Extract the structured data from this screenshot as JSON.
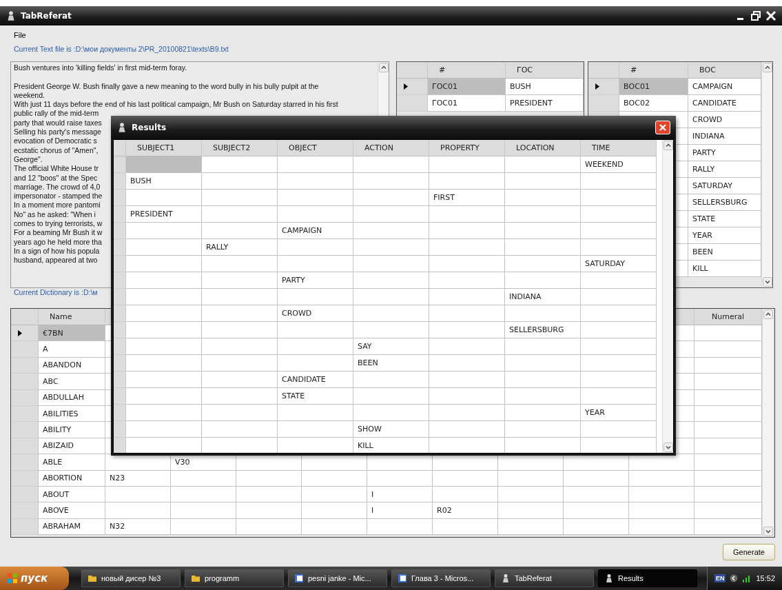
{
  "window": {
    "title": "TabReferat"
  },
  "menu": [
    "File"
  ],
  "text_file_label": "Current Text file is :D:\\мои документы 2\\PR_20100821\\texts\\B9.txt",
  "text_heading": "Bush ventures into 'killing fields' in first mid-term foray.",
  "text_lines": [
    "President George W. Bush finally gave a new meaning to the word bully in his bully pulpit at the",
    "weekend.",
    "With just 11 days before the end of his last political campaign, Mr Bush on Saturday starred in his first",
    "public rally of the mid-term",
    "party that would raise taxes",
    "Selling his party's message",
    "evocation of Democratic s",
    "ecstatic chorus of \"Amen\",",
    "George\".",
    "The official White House tr",
    "and 12 \"boos\" at the Spec",
    "marriage. The crowd of 4,0",
    "impersonator - stamped the",
    "In a moment more pantomi",
    "No\" as he asked: \"When i",
    "comes to trying terrorists, w",
    "For a beaming Mr Bush it w",
    "years ago he held more tha",
    "In a sign of how his popula",
    "husband, appeared at two"
  ],
  "goc_grid": {
    "columns": [
      "#",
      "ГОС"
    ],
    "rows": [
      {
        "code": "ГОС01",
        "word": "BUSH",
        "selected": true
      },
      {
        "code": "ГОС01",
        "word": "PRESIDENT",
        "selected": false
      }
    ]
  },
  "voc_grid": {
    "columns": [
      "#",
      "ВОС"
    ],
    "rows": [
      {
        "code": "ВОС01",
        "word": "CAMPAIGN",
        "selected": true
      },
      {
        "code": "ВОС02",
        "word": "CANDIDATE",
        "selected": false
      },
      {
        "word": "CROWD",
        "selected": false
      },
      {
        "word": "INDIANA"
      },
      {
        "word": "PARTY"
      },
      {
        "word": "RALLY"
      },
      {
        "word": "SATURDAY"
      },
      {
        "word": "SELLERSBURG"
      },
      {
        "word": "STATE"
      },
      {
        "word": "YEAR"
      },
      {
        "word": "BEEN"
      },
      {
        "word": "KILL"
      }
    ]
  },
  "dictionary_label": "Current Dictionary is :D:\\м",
  "dictionary": {
    "name_header": "Name",
    "numeral_header": "Numeral",
    "rows": [
      {
        "cells": [
          "€7BN",
          null,
          null,
          null,
          null,
          null,
          null,
          null,
          null,
          null,
          null
        ],
        "selected": true
      },
      {
        "cells": [
          "A",
          null,
          null,
          null,
          null,
          null,
          null,
          null,
          null,
          null,
          null
        ],
        "selected": false
      },
      {
        "cells": [
          "ABANDON",
          null,
          null,
          null,
          null,
          null,
          null,
          null,
          null,
          null,
          null
        ],
        "selected": false
      },
      {
        "cells": [
          "ABC",
          null,
          null,
          null,
          null,
          null,
          null,
          null,
          null,
          null,
          null
        ],
        "selected": false
      },
      {
        "cells": [
          "ABDULLAH",
          null,
          null,
          null,
          null,
          null,
          null,
          null,
          null,
          null,
          null
        ],
        "selected": false
      },
      {
        "cells": [
          "ABILITIES",
          null,
          null,
          null,
          null,
          null,
          null,
          null,
          null,
          null,
          null
        ],
        "selected": false
      },
      {
        "cells": [
          "ABILITY",
          null,
          null,
          null,
          null,
          null,
          null,
          null,
          null,
          null,
          null
        ],
        "selected": false
      },
      {
        "cells": [
          "ABIZAID",
          null,
          null,
          null,
          null,
          null,
          null,
          null,
          null,
          null,
          null
        ],
        "selected": false
      },
      {
        "cells": [
          "ABLE",
          null,
          "V30",
          null,
          null,
          null,
          null,
          null,
          null,
          null,
          null
        ],
        "selected": false
      },
      {
        "cells": [
          "ABORTION",
          "N23",
          null,
          null,
          null,
          null,
          null,
          null,
          null,
          null,
          null
        ],
        "selected": false
      },
      {
        "cells": [
          "ABOUT",
          null,
          null,
          null,
          null,
          "I",
          null,
          null,
          null,
          null,
          null
        ],
        "selected": false
      },
      {
        "cells": [
          "ABOVE",
          null,
          null,
          null,
          null,
          "I",
          "R02",
          null,
          null,
          null,
          null
        ],
        "selected": false
      },
      {
        "cells": [
          "ABRAHAM",
          "N32",
          null,
          null,
          null,
          null,
          null,
          null,
          null,
          null,
          null
        ],
        "selected": false
      }
    ]
  },
  "generate_button": "Generate",
  "results_window": {
    "title": "Results",
    "columns": [
      "SUBJECT1",
      "SUBJECT2",
      "OBJECT",
      "ACTION",
      "PROPERTY",
      "LOCATION",
      "TIME"
    ],
    "rows": [
      {
        "cells": [
          null,
          null,
          null,
          null,
          null,
          null,
          "WEEKEND"
        ],
        "selected": true
      },
      {
        "cells": [
          "BUSH",
          null,
          null,
          null,
          null,
          null,
          null
        ],
        "selected": false
      },
      {
        "cells": [
          null,
          null,
          null,
          null,
          "FIRST",
          null,
          null
        ],
        "selected": false
      },
      {
        "cells": [
          "PRESIDENT",
          null,
          null,
          null,
          null,
          null,
          null
        ],
        "selected": false
      },
      {
        "cells": [
          null,
          null,
          "CAMPAIGN",
          null,
          null,
          null,
          null
        ],
        "selected": false
      },
      {
        "cells": [
          null,
          "RALLY",
          null,
          null,
          null,
          null,
          null
        ],
        "selected": false
      },
      {
        "cells": [
          null,
          null,
          null,
          null,
          null,
          null,
          "SATURDAY"
        ],
        "selected": false
      },
      {
        "cells": [
          null,
          null,
          "PARTY",
          null,
          null,
          null,
          null
        ],
        "selected": false
      },
      {
        "cells": [
          null,
          null,
          null,
          null,
          null,
          "INDIANA",
          null
        ],
        "selected": false
      },
      {
        "cells": [
          null,
          null,
          "CROWD",
          null,
          null,
          null,
          null
        ],
        "selected": false
      },
      {
        "cells": [
          null,
          null,
          null,
          null,
          null,
          "SELLERSBURG",
          null
        ],
        "selected": false
      },
      {
        "cells": [
          null,
          null,
          null,
          "SAY",
          null,
          null,
          null
        ],
        "selected": false
      },
      {
        "cells": [
          null,
          null,
          null,
          "BEEN",
          null,
          null,
          null
        ],
        "selected": false
      },
      {
        "cells": [
          null,
          null,
          "CANDIDATE",
          null,
          null,
          null,
          null
        ],
        "selected": false
      },
      {
        "cells": [
          null,
          null,
          "STATE",
          null,
          null,
          null,
          null
        ],
        "selected": false
      },
      {
        "cells": [
          null,
          null,
          null,
          null,
          null,
          null,
          "YEAR"
        ],
        "selected": false
      },
      {
        "cells": [
          null,
          null,
          null,
          "SHOW",
          null,
          null,
          null
        ],
        "selected": false
      },
      {
        "cells": [
          null,
          null,
          null,
          "KILL",
          null,
          null,
          null
        ],
        "selected": false
      }
    ]
  },
  "taskbar": {
    "start": "пуск",
    "items": [
      {
        "label": "новый дисер №3",
        "kind": "folder",
        "selected": false
      },
      {
        "label": "programm",
        "kind": "folder",
        "selected": false
      },
      {
        "label": "pesni janke - Mic...",
        "kind": "document",
        "selected": false
      },
      {
        "label": "Глава 3 - Micros...",
        "kind": "document",
        "selected": false
      },
      {
        "label": "TabReferat",
        "kind": "app",
        "selected": false
      },
      {
        "label": "Results",
        "kind": "app",
        "selected": true
      }
    ],
    "language": "EN",
    "clock": "15:52"
  }
}
